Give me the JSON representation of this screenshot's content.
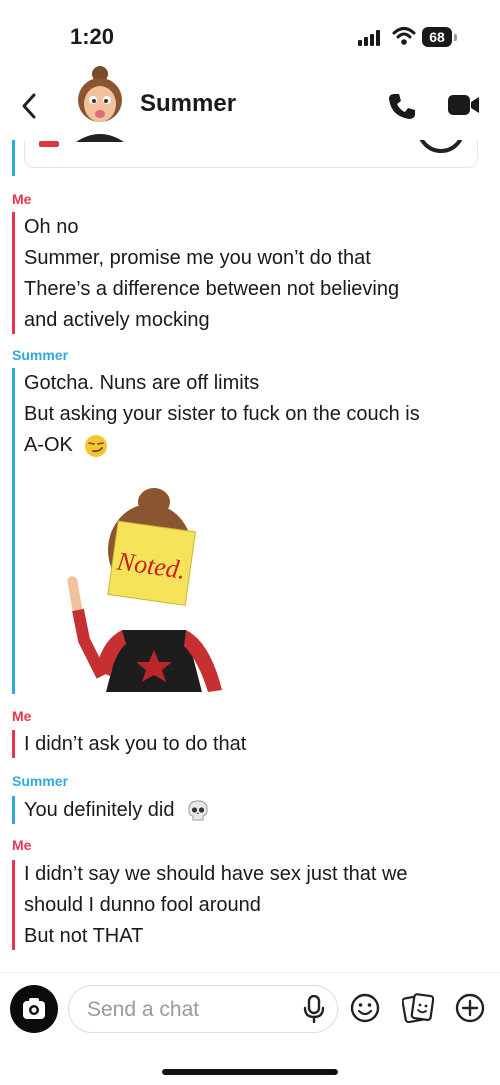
{
  "status": {
    "time": "1:20",
    "battery": "68"
  },
  "header": {
    "contact_name": "Summer",
    "avatar_icon": "bitmoji-avatar",
    "colors": {
      "me": "#e8364f",
      "them": "#2fa8e0"
    }
  },
  "messages": [
    {
      "sender": "Me",
      "lines": [
        "Oh no",
        "Summer, promise me you won’t do that",
        "There’s a difference between not believing",
        "and actively mocking"
      ]
    },
    {
      "sender": "Summer",
      "lines": [
        "Gotcha. Nuns are off limits",
        "But asking your sister to fuck on the couch is",
        "A-OK"
      ],
      "emoji": "smirk-emoji",
      "sticker_text": "Noted."
    },
    {
      "sender": "Me",
      "lines": [
        "I didn’t ask you to do that"
      ]
    },
    {
      "sender": "Summer",
      "lines": [
        "You definitely did"
      ],
      "emoji": "skull-emoji"
    },
    {
      "sender": "Me",
      "lines": [
        "I didn’t say we should have sex just that we",
        "should I dunno fool around",
        "But not THAT"
      ]
    }
  ],
  "composer": {
    "placeholder": "Send a chat"
  }
}
